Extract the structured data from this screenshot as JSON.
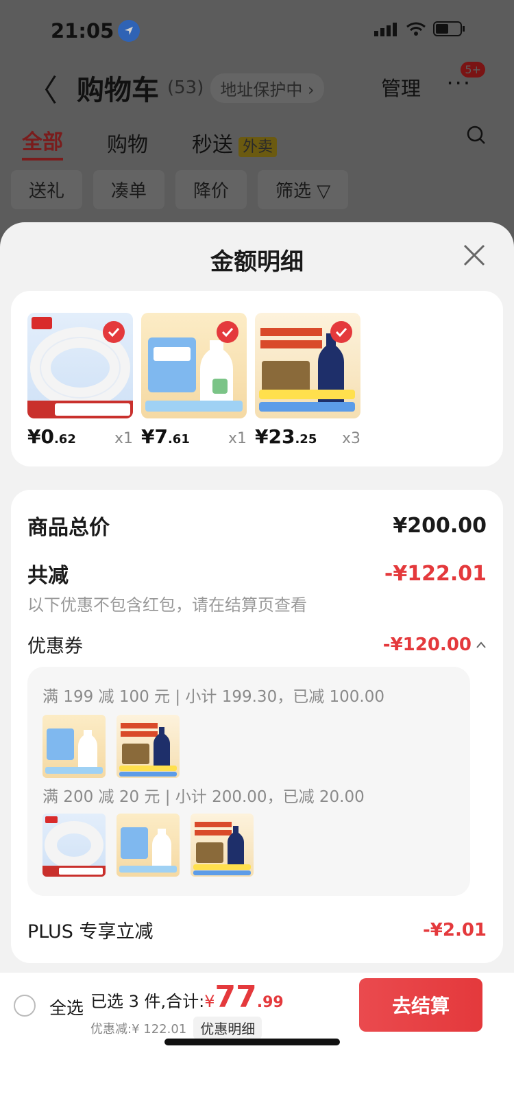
{
  "status_bar": {
    "time": "21:05"
  },
  "header": {
    "back": "〈",
    "title": "购物车",
    "count": "(53)",
    "address_guard": "地址保护中 ›",
    "manage": "管理",
    "more": "···",
    "more_badge": "5+"
  },
  "tabs": [
    {
      "label": "全部",
      "active": true
    },
    {
      "label": "购物"
    },
    {
      "label": "秒送",
      "tag": "外卖"
    }
  ],
  "filters": [
    "送礼",
    "凑单",
    "降价",
    "筛选 ▽"
  ],
  "sheet": {
    "title": "金额明细",
    "products": [
      {
        "name": "tape",
        "price_main": "¥0",
        "price_dec": ".62",
        "qty": "x1"
      },
      {
        "name": "milk",
        "price_main": "¥7",
        "price_dec": ".61",
        "qty": "x1"
      },
      {
        "name": "coffee",
        "price_main": "¥23",
        "price_dec": ".25",
        "qty": "x3"
      }
    ],
    "total_label": "商品总价",
    "total_value": "¥200.00",
    "reduce_label": "共减",
    "reduce_value": "-¥122.01",
    "reduce_note": "以下优惠不包含红包，请在结算页查看",
    "coupon_label": "优惠券",
    "coupon_value": "-¥120.00",
    "coupons": [
      {
        "text": "满 199 减 100 元 | 小计 199.30，已减 100.00"
      },
      {
        "text": "满 200 减 20 元 | 小计 200.00，已减 20.00"
      }
    ],
    "plus_label": "PLUS 专享立减",
    "plus_value": "-¥2.01"
  },
  "bottom": {
    "select_all": "全选",
    "selected_text": "已选 3 件,合计:",
    "currency": "¥",
    "total_int": "77",
    "total_dec": ".99",
    "discount_text": "优惠减:¥ 122.01",
    "detail_label": "优惠明细",
    "checkout": "去结算"
  },
  "colors": {
    "accent_red": "#e4393c",
    "overlay": "#5c5c5c",
    "sheet_bg": "#f2f2f2"
  }
}
